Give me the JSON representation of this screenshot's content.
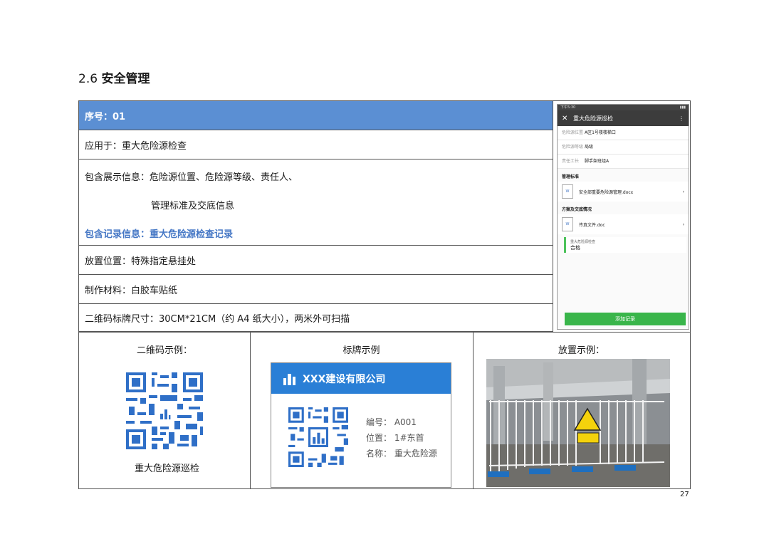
{
  "heading": {
    "number": "2.6",
    "title": "安全管理"
  },
  "rows": {
    "seq": "序号：01",
    "apply": "应用于：重大危险源检查",
    "info_line1": "包含展示信息：危险源位置、危险源等级、责任人、",
    "info_line2": "管理标准及交底信息",
    "record": "包含记录信息：重大危险源检查记录",
    "place": "放置位置：特殊指定悬挂处",
    "material": "制作材料：白胶车贴纸",
    "size": "二维码标牌尺寸：30CM*21CM（约 A4 纸大小），两米外可扫描"
  },
  "phone": {
    "status_time": "下午5:30",
    "title": "重大危险源巡检",
    "fields": [
      {
        "k": "危险源位置",
        "v": "A区1号楼楼梯口"
      },
      {
        "k": "危险源等级",
        "v": "局级"
      },
      {
        "k": "责任工长",
        "v": "脚手架班组A"
      }
    ],
    "sec1": "管理标准",
    "file1": "安全部重要危险源管理.docx",
    "sec2": "方案及交底情况",
    "file2": "传真文件.doc",
    "check_label": "重大危险源检查",
    "check_value": "合格",
    "add_button": "添加记录"
  },
  "examples": {
    "qr_title": "二维码示例：",
    "qr_caption": "重大危险源巡检",
    "sign_title": "标牌示例",
    "place_title": "放置示例："
  },
  "sign": {
    "company": "XXX建设有限公司",
    "code": "编号： A001",
    "location": "位置： 1#东首",
    "name": "名称： 重大危险源"
  },
  "page_number": "27",
  "colors": {
    "header_blue": "#5b8fd3",
    "record_blue": "#4577c5",
    "qr_blue": "#2f6fc7",
    "sign_blue": "#2a7fd6",
    "button_green": "#39b54a"
  }
}
